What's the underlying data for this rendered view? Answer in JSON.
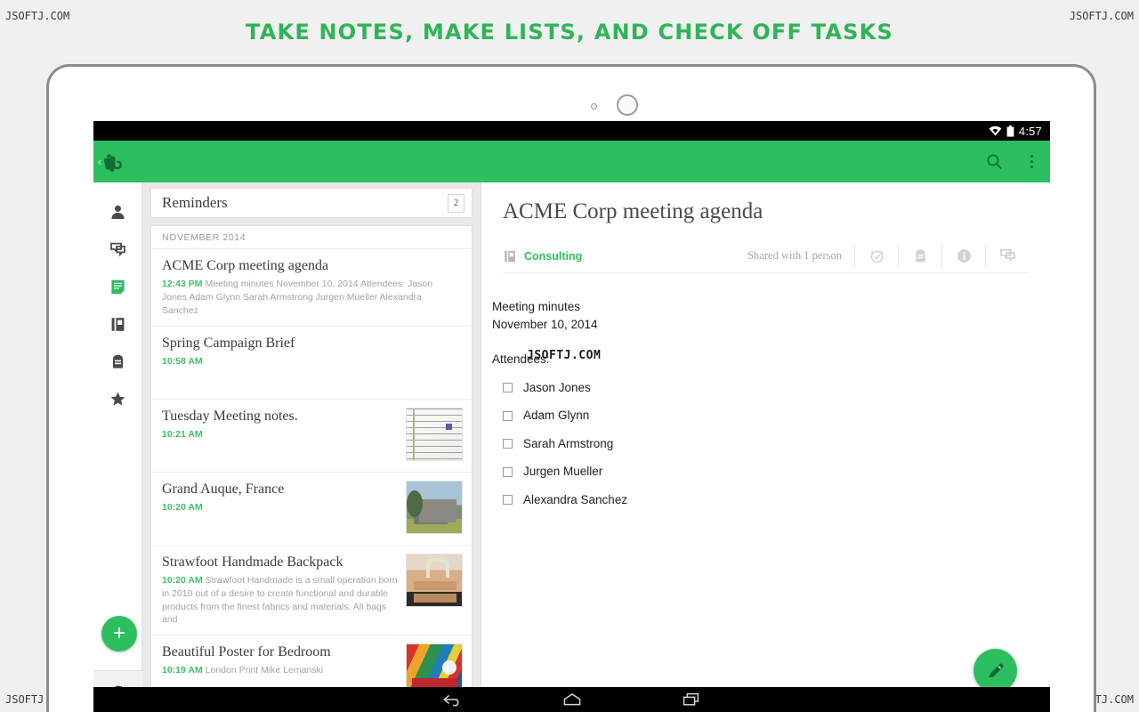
{
  "promo": {
    "title": "TAKE NOTES, MAKE LISTS, AND CHECK OFF TASKS",
    "accent_color": "#2fb457"
  },
  "watermarks": {
    "top_left": "JSOFTJ.COM",
    "top_right": "JSOFTJ.COM",
    "bottom_left": "JSOFTJ.COM",
    "bottom_right": "JSOFTJ.COM",
    "overlay": "JSOFTJ.COM"
  },
  "status_bar": {
    "time": "4:57",
    "wifi_icon": "wifi-icon",
    "battery_icon": "battery-icon"
  },
  "app_bar": {
    "brand_icon": "evernote-elephant-icon",
    "back_chevron": "‹",
    "search_icon": "search-icon",
    "overflow_icon": "overflow-menu-icon",
    "background_color": "#2dbe60"
  },
  "rail": {
    "items": [
      {
        "name": "account",
        "icon": "person-icon",
        "active": false
      },
      {
        "name": "chat",
        "icon": "chat-icon",
        "active": false
      },
      {
        "name": "notes",
        "icon": "note-icon",
        "active": true
      },
      {
        "name": "notebooks",
        "icon": "notebook-icon",
        "active": false
      },
      {
        "name": "tags",
        "icon": "tag-icon",
        "active": false
      },
      {
        "name": "shortcuts",
        "icon": "star-icon",
        "active": false
      }
    ],
    "new_note_label": "+",
    "sync_icon": "sync-icon"
  },
  "note_list": {
    "reminders": {
      "label": "Reminders",
      "count": "2"
    },
    "section_header": "NOVEMBER 2014",
    "notes": [
      {
        "title": "ACME Corp meeting agenda",
        "time": "12:43 PM",
        "snippet": "Meeting minutes November 10, 2014 Attendees: Jason Jones Adam Glynn Sarah Armstrong Jurgen Mueller Alexandra Sanchez",
        "thumb": "none"
      },
      {
        "title": "Spring Campaign Brief",
        "time": "10:58 AM",
        "snippet": "",
        "thumb": "none"
      },
      {
        "title": "Tuesday Meeting notes.",
        "time": "10:21 AM",
        "snippet": "",
        "thumb": "handwritten-page"
      },
      {
        "title": "Grand Auque, France",
        "time": "10:20 AM",
        "snippet": "",
        "thumb": "barn-photo"
      },
      {
        "title": "Strawfoot Handmade Backpack",
        "time": "10:20 AM",
        "snippet": "Strawfoot Handmade is a small operation born in 2010 out of a desire to create functional and durable products from the finest fabrics and materials. All bags and",
        "thumb": "backpack-photo"
      },
      {
        "title": "Beautiful  Poster for Bedroom",
        "time": "10:19 AM",
        "snippet": "London Print Mike Lemanski",
        "thumb": "poster-art"
      }
    ]
  },
  "note_detail": {
    "title": "ACME Corp meeting agenda",
    "notebook_icon": "notebook-icon",
    "notebook": "Consulting",
    "shared_text": "Shared with 1 person",
    "toolbar_icons": [
      "reminder-alarm-icon",
      "tag-icon",
      "info-icon",
      "chat-icon"
    ],
    "body": {
      "line1": "Meeting minutes",
      "line2": "November 10, 2014",
      "attendees_label": "Attendees:",
      "attendees": [
        {
          "name": "Jason Jones",
          "checked": false
        },
        {
          "name": "Adam Glynn",
          "checked": false
        },
        {
          "name": "Sarah Armstrong",
          "checked": false
        },
        {
          "name": "Jurgen Mueller",
          "checked": false
        },
        {
          "name": "Alexandra Sanchez",
          "checked": false
        }
      ]
    },
    "edit_fab_icon": "pencil-icon"
  },
  "nav_bar": {
    "back_icon": "back-arrow-icon",
    "home_icon": "home-icon",
    "recents_icon": "recents-icon"
  }
}
